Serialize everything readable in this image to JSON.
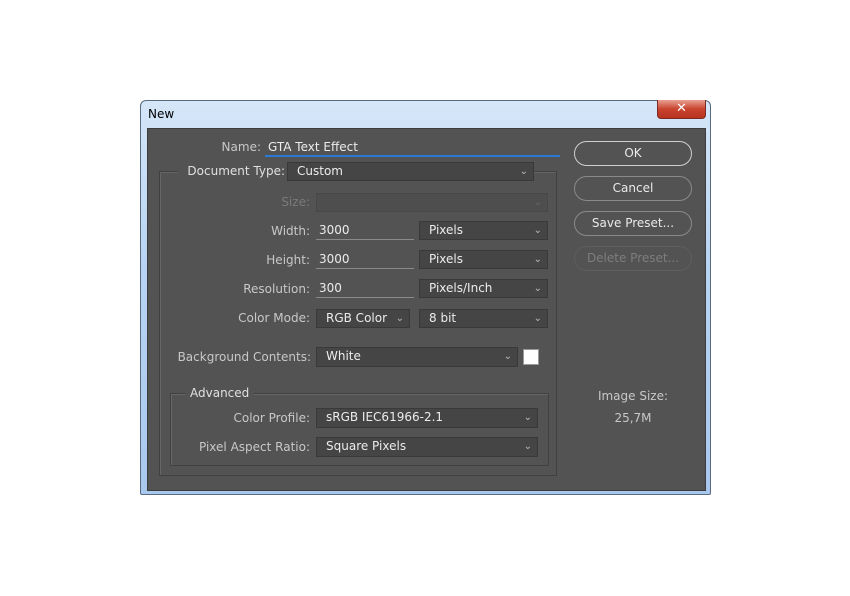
{
  "window": {
    "title": "New",
    "close": "✕"
  },
  "name": {
    "label": "Name:",
    "value": "GTA Text Effect"
  },
  "document_type": {
    "label": "Document Type:",
    "value": "Custom"
  },
  "size": {
    "label": "Size:",
    "value": ""
  },
  "width": {
    "label": "Width:",
    "value": "3000",
    "unit": "Pixels"
  },
  "height": {
    "label": "Height:",
    "value": "3000",
    "unit": "Pixels"
  },
  "resolution": {
    "label": "Resolution:",
    "value": "300",
    "unit": "Pixels/Inch"
  },
  "color_mode": {
    "label": "Color Mode:",
    "value": "RGB Color",
    "depth": "8 bit"
  },
  "background": {
    "label": "Background Contents:",
    "value": "White",
    "swatch": "#ffffff"
  },
  "advanced": {
    "label": "Advanced",
    "color_profile_label": "Color Profile:",
    "color_profile": "sRGB IEC61966-2.1",
    "pixel_aspect_label": "Pixel Aspect Ratio:",
    "pixel_aspect": "Square Pixels"
  },
  "buttons": {
    "ok": "OK",
    "cancel": "Cancel",
    "save_preset": "Save Preset...",
    "delete_preset": "Delete Preset..."
  },
  "image_size": {
    "label": "Image Size:",
    "value": "25,7M"
  },
  "chevron": "⌄"
}
